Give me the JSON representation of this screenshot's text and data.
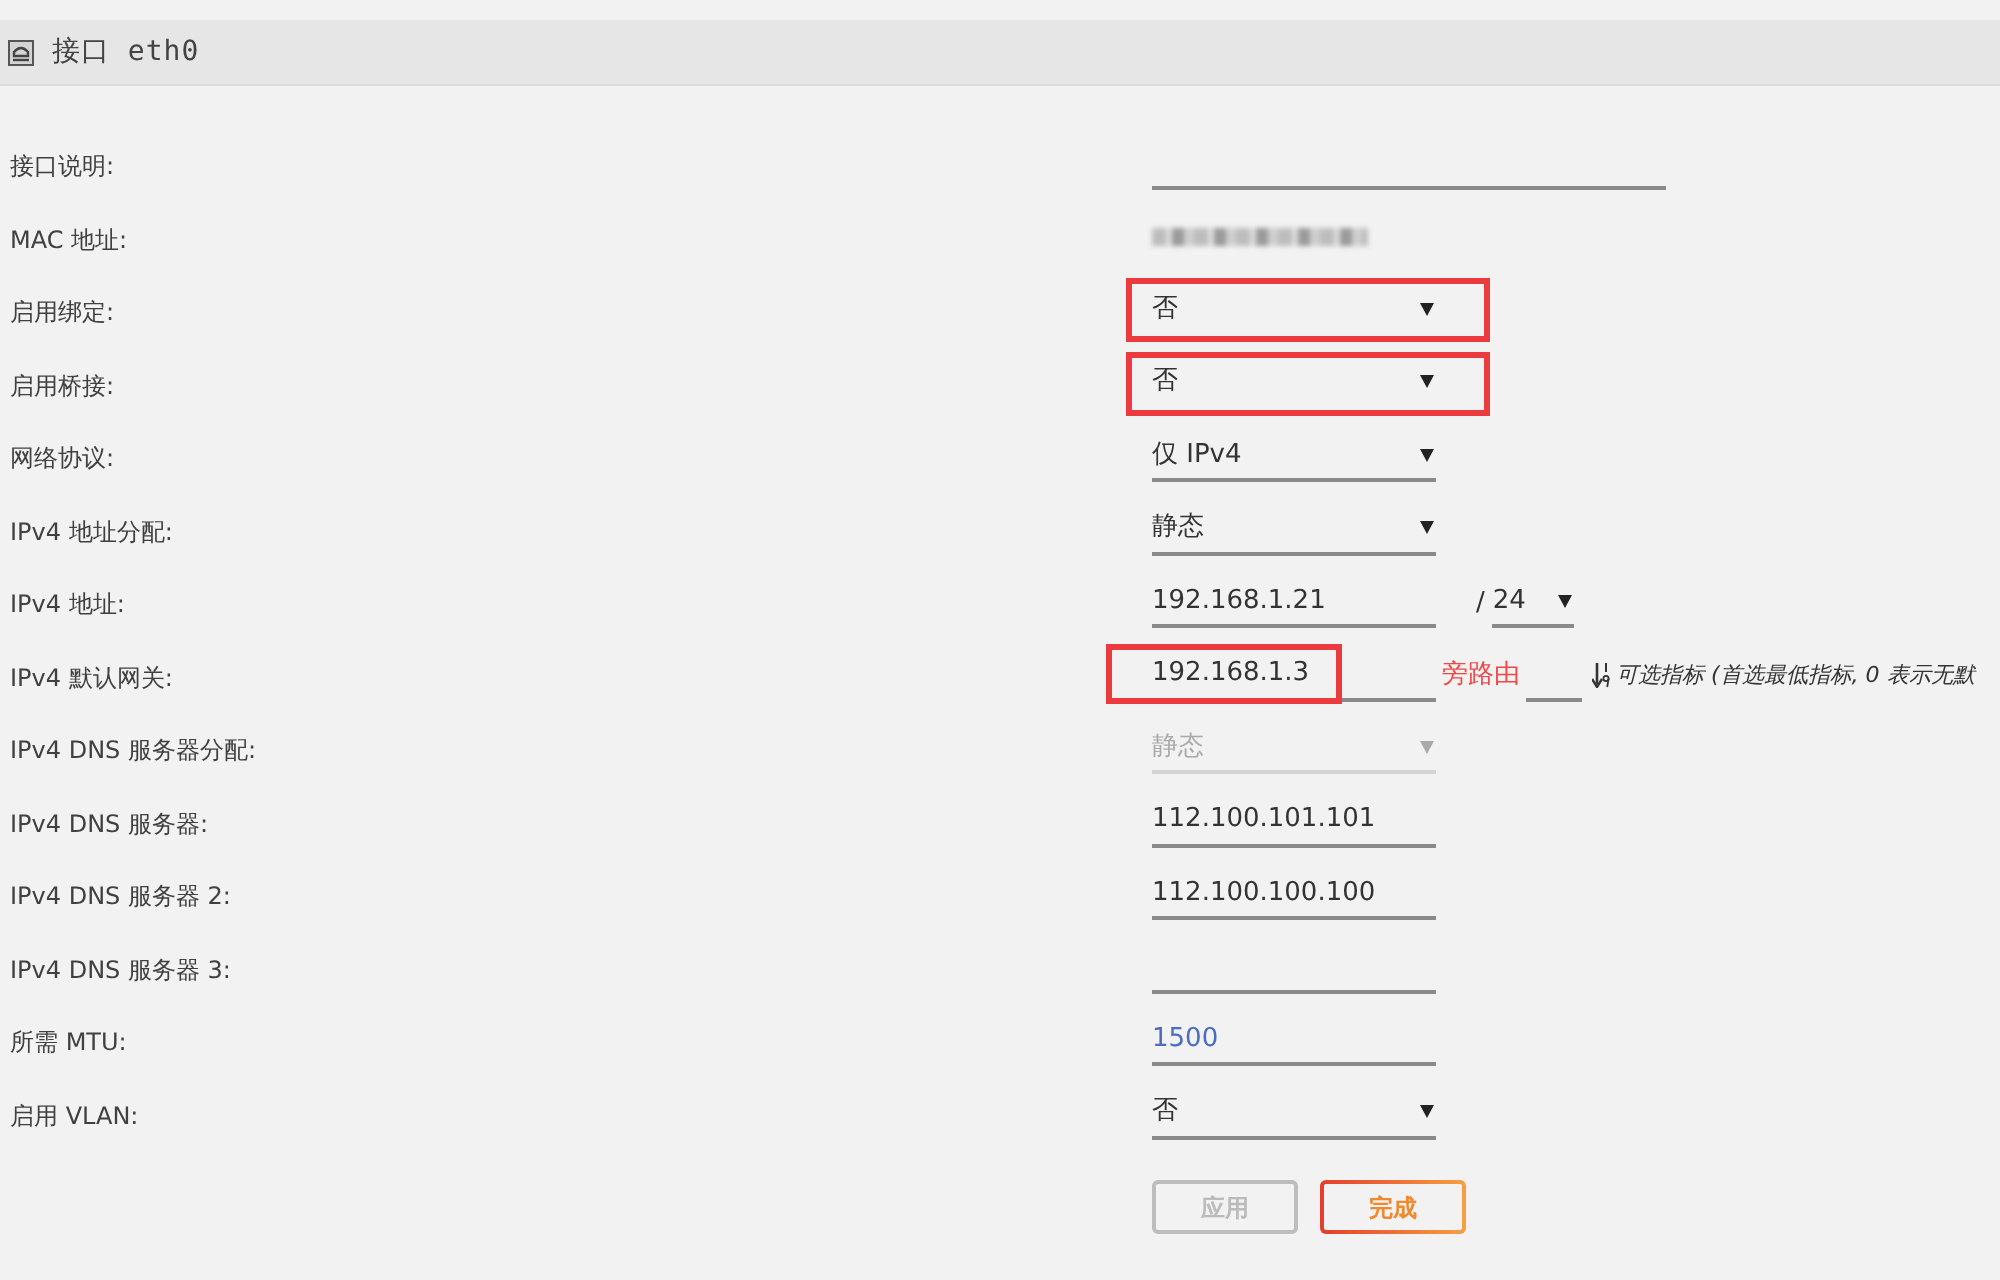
{
  "header": {
    "title": "接口 eth0"
  },
  "rows": [
    {
      "label": "接口说明:",
      "kind": "longtext",
      "highlighted": false
    },
    {
      "label": "MAC 地址:",
      "kind": "blurred",
      "highlighted": false
    },
    {
      "label": "启用绑定:",
      "kind": "select",
      "value": "否",
      "highlighted": true,
      "disabled": false
    },
    {
      "label": "启用桥接:",
      "kind": "select",
      "value": "否",
      "highlighted": true,
      "disabled": false
    },
    {
      "label": "网络协议:",
      "kind": "select",
      "value": "仅 IPv4",
      "highlighted": false,
      "disabled": false
    },
    {
      "label": "IPv4 地址分配:",
      "kind": "select",
      "value": "静态",
      "highlighted": false,
      "disabled": false
    },
    {
      "label": "IPv4 地址:",
      "kind": "address",
      "value": "192.168.1.21",
      "separator": "/",
      "prefix": "24",
      "highlighted": false
    },
    {
      "label": "IPv4 默认网关:",
      "kind": "gateway",
      "value": "192.168.1.3",
      "note": "旁路由",
      "metric_hint": "可选指标 (首选最低指标, 0 表示无默",
      "highlighted": true
    },
    {
      "label": "IPv4 DNS 服务器分配:",
      "kind": "select",
      "value": "静态",
      "highlighted": false,
      "disabled": true
    },
    {
      "label": "IPv4 DNS 服务器:",
      "kind": "text",
      "value": "112.100.101.101",
      "highlighted": false
    },
    {
      "label": "IPv4 DNS 服务器 2:",
      "kind": "text",
      "value": "112.100.100.100",
      "highlighted": false
    },
    {
      "label": "IPv4 DNS 服务器 3:",
      "kind": "text",
      "highlighted": false
    },
    {
      "label": "所需 MTU:",
      "kind": "text",
      "placeholder": "1500",
      "highlighted": false
    },
    {
      "label": "启用 VLAN:",
      "kind": "select",
      "value": "否",
      "highlighted": false,
      "disabled": false
    }
  ],
  "buttons": [
    {
      "label": "应用",
      "disabled": true
    },
    {
      "label": "完成",
      "disabled": false
    }
  ]
}
